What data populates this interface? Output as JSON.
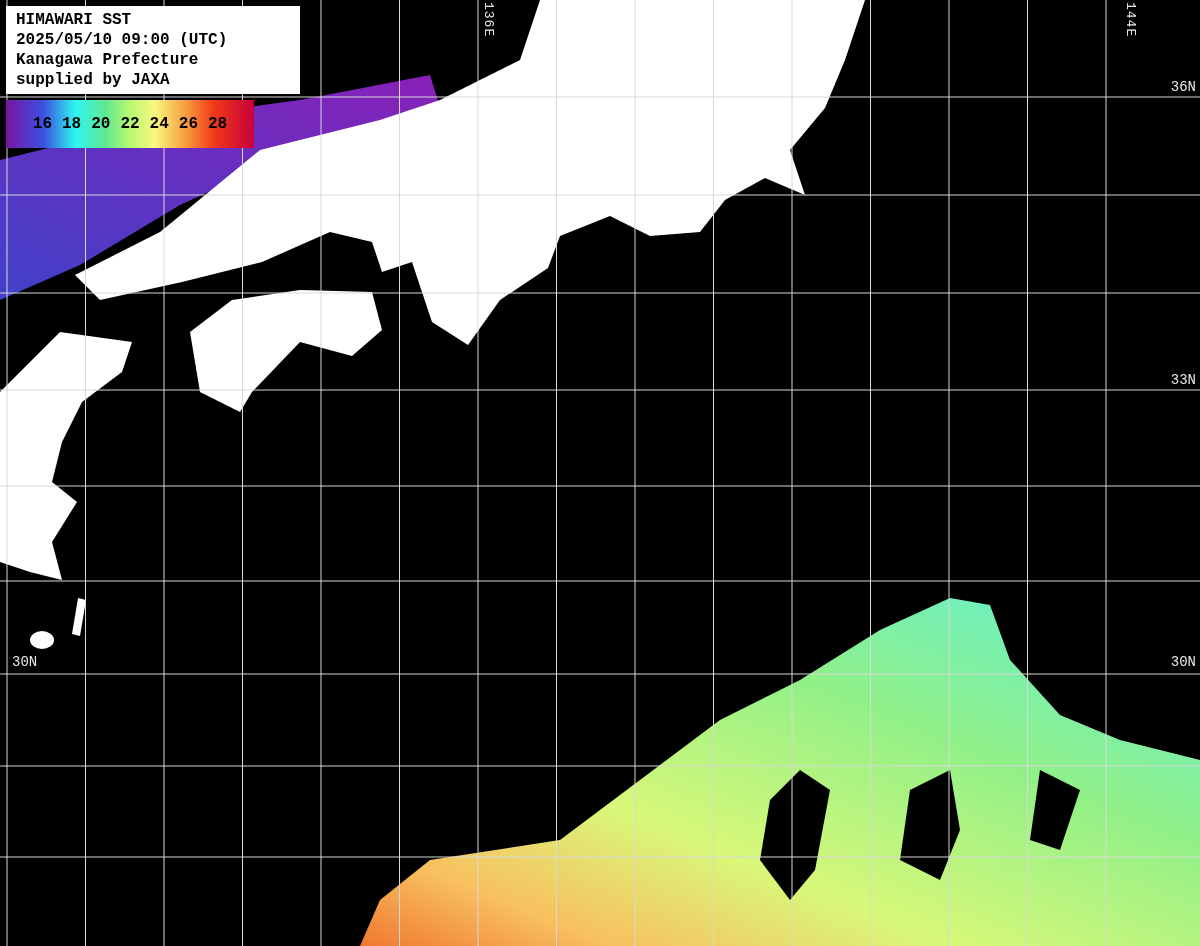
{
  "info_box": {
    "lines": [
      "HIMAWARI SST",
      "2025/05/10 09:00 (UTC)",
      "Kanagawa Prefecture",
      "supplied by JAXA"
    ]
  },
  "legend": {
    "labels": [
      "16",
      "18",
      "20",
      "22",
      "24",
      "26",
      "28"
    ]
  },
  "longitude_labels": [
    {
      "text": "136E"
    },
    {
      "text": "144E"
    }
  ],
  "latitude_labels": [
    {
      "text": "36N"
    },
    {
      "text": "33N"
    },
    {
      "text": "30N"
    },
    {
      "text": "30N"
    }
  ]
}
